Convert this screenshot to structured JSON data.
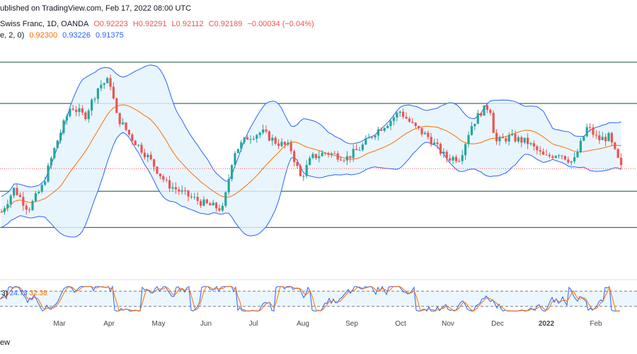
{
  "header": {
    "published": "ublished on TradingView.com, Feb 17, 2022 08:00 UTC",
    "symbol": "Swiss Franc, 1D, OANDA",
    "o": "O0.92223",
    "h": "H0.92291",
    "l": "L0.92112",
    "c": "C0.92189",
    "chg": "−0.00034 (−0.04%)",
    "bb_params": "e, 2, 0)",
    "bb_basis": "0.92300",
    "bb_upper": "0.93226",
    "bb_lower": "0.91375"
  },
  "stoch": {
    "label_prefix": "3)",
    "k": "24.73",
    "d": "32.38"
  },
  "footer": {
    "text": "ew"
  },
  "colors": {
    "up": "#26a69a",
    "down": "#ef5350",
    "bb_line": "#2962ff",
    "bb_fill": "#e3f2fd",
    "basis": "#ff6d00",
    "hline": "#0e4f3a",
    "price_line": "#ef5350",
    "stoch_k": "#2962ff",
    "stoch_d": "#ff6d00"
  },
  "chart_data": {
    "type": "candlestick",
    "x_tick_labels": [
      "Mar",
      "Apr",
      "May",
      "Jun",
      "Jul",
      "Aug",
      "Sep",
      "Oct",
      "Nov",
      "Dec",
      "2022",
      "Feb"
    ],
    "horizontal_levels": [
      0.9425,
      0.9345,
      0.9175,
      0.9105
    ],
    "price_line": 0.92189,
    "indicators": [
      "Bollinger Bands",
      "Stochastic RSI"
    ]
  }
}
